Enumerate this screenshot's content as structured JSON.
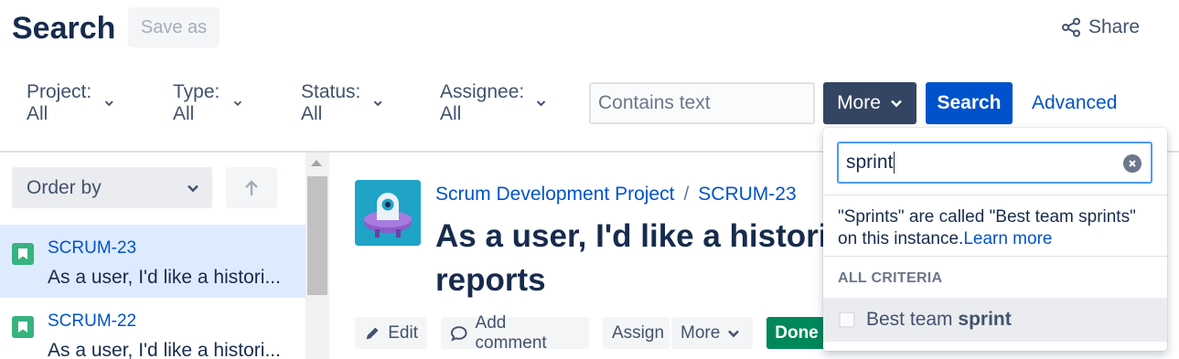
{
  "header": {
    "title": "Search",
    "save_as_label": "Save as",
    "share_label": "Share"
  },
  "filters": {
    "project": "Project: All",
    "type": "Type: All",
    "status": "Status: All",
    "assignee": "Assignee: All",
    "text_placeholder": "Contains text",
    "more_label": "More",
    "search_label": "Search",
    "advanced_label": "Advanced"
  },
  "list": {
    "order_by_label": "Order by",
    "items": [
      {
        "key": "SCRUM-23",
        "summary": "As a user, I'd like a histori...",
        "selected": true
      },
      {
        "key": "SCRUM-22",
        "summary": "As a user, I'd like a histori...",
        "selected": false
      }
    ]
  },
  "issue": {
    "project_link": "Scrum Development Project",
    "separator": "/",
    "key": "SCRUM-23",
    "title_line1": "As a user, I'd like a historica",
    "title_line2": "reports",
    "actions": {
      "edit": "Edit",
      "add_comment": "Add comment",
      "assign": "Assign",
      "more": "More",
      "done": "Done"
    }
  },
  "more_dropdown": {
    "search_value": "sprint",
    "note": "\"Sprints\" are called \"Best team sprints\" on this instance.",
    "learn_more": "Learn more",
    "section_heading": "ALL CRITERIA",
    "option_prefix": "Best team ",
    "option_match": "sprint"
  },
  "colors": {
    "primary": "#0052CC",
    "dark_button": "#344563",
    "done_green": "#00875A",
    "selected_row": "#DEEBFF",
    "story_icon": "#36B37E"
  }
}
